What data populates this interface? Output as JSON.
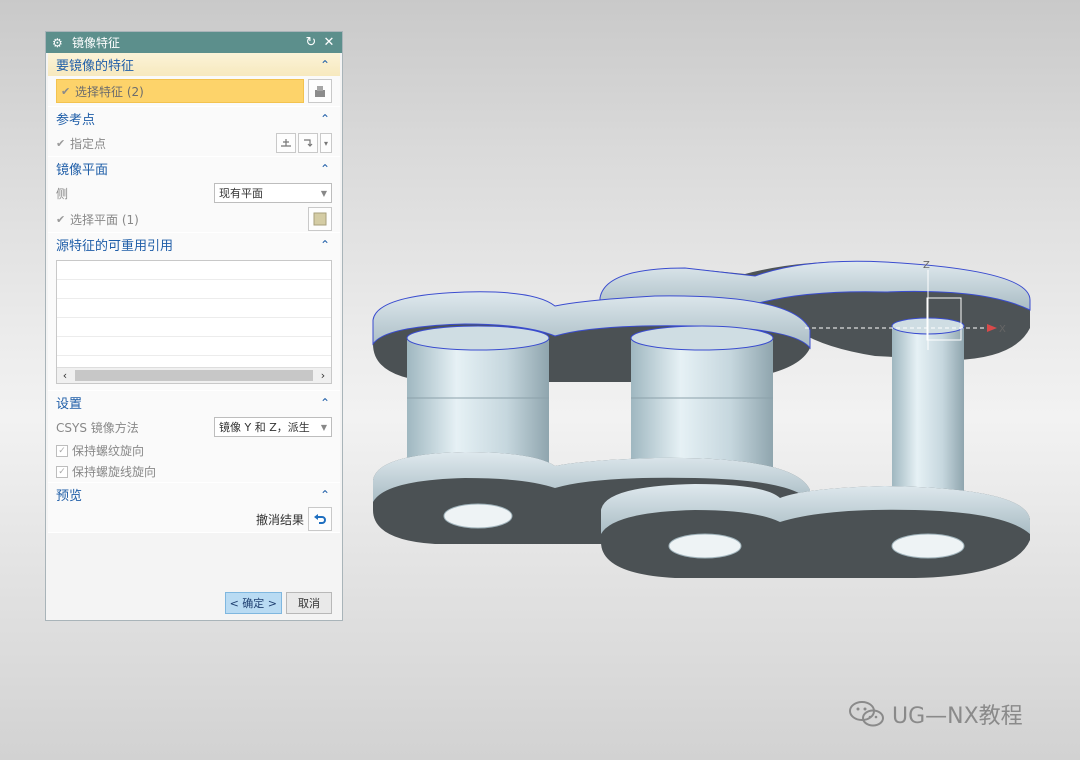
{
  "dialog": {
    "title": "镜像特征",
    "sections": {
      "features": {
        "header": "要镜像的特征",
        "select_label": "选择特征 (2)"
      },
      "ref_point": {
        "header": "参考点",
        "point_label": "指定点"
      },
      "mirror_plane": {
        "header": "镜像平面",
        "plane_label": "侧",
        "plane_value": "现有平面",
        "select_plane_label": "选择平面 (1)"
      },
      "reuse_refs": {
        "header": "源特征的可重用引用"
      },
      "settings": {
        "header": "设置",
        "csys_label": "CSYS 镜像方法",
        "csys_value": "镜像 Y 和 Z，派生",
        "keep_thread_label": "保持螺纹旋向",
        "keep_helix_label": "保持螺旋线旋向"
      },
      "preview": {
        "header": "预览",
        "undo_label": "撤消结果"
      }
    },
    "ok_label": "< 确定 >",
    "cancel_label": "取消"
  },
  "viewport": {
    "axis_z": "Z",
    "axis_x": "X"
  },
  "watermark": {
    "text": "UG—NX教程"
  },
  "colors": {
    "titlebar": "#5c8f8c",
    "header_text": "#1f5ea8",
    "selection": "#fdd36a",
    "ok_button": "#b9dbf3"
  }
}
